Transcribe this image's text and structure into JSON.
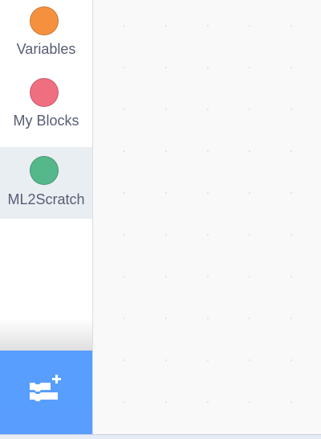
{
  "categories": [
    {
      "label": "Variables",
      "color": "#ff8c1a",
      "selected": false
    },
    {
      "label": "My Blocks",
      "color": "#ff6680",
      "selected": false
    },
    {
      "label": "ML2Scratch",
      "color": "#3fbf7f",
      "selected": true
    }
  ],
  "extension_button": {
    "icon": "add-extension-icon",
    "color": "#4c97ff"
  },
  "workspace": {
    "background": "#f9f9f9"
  }
}
